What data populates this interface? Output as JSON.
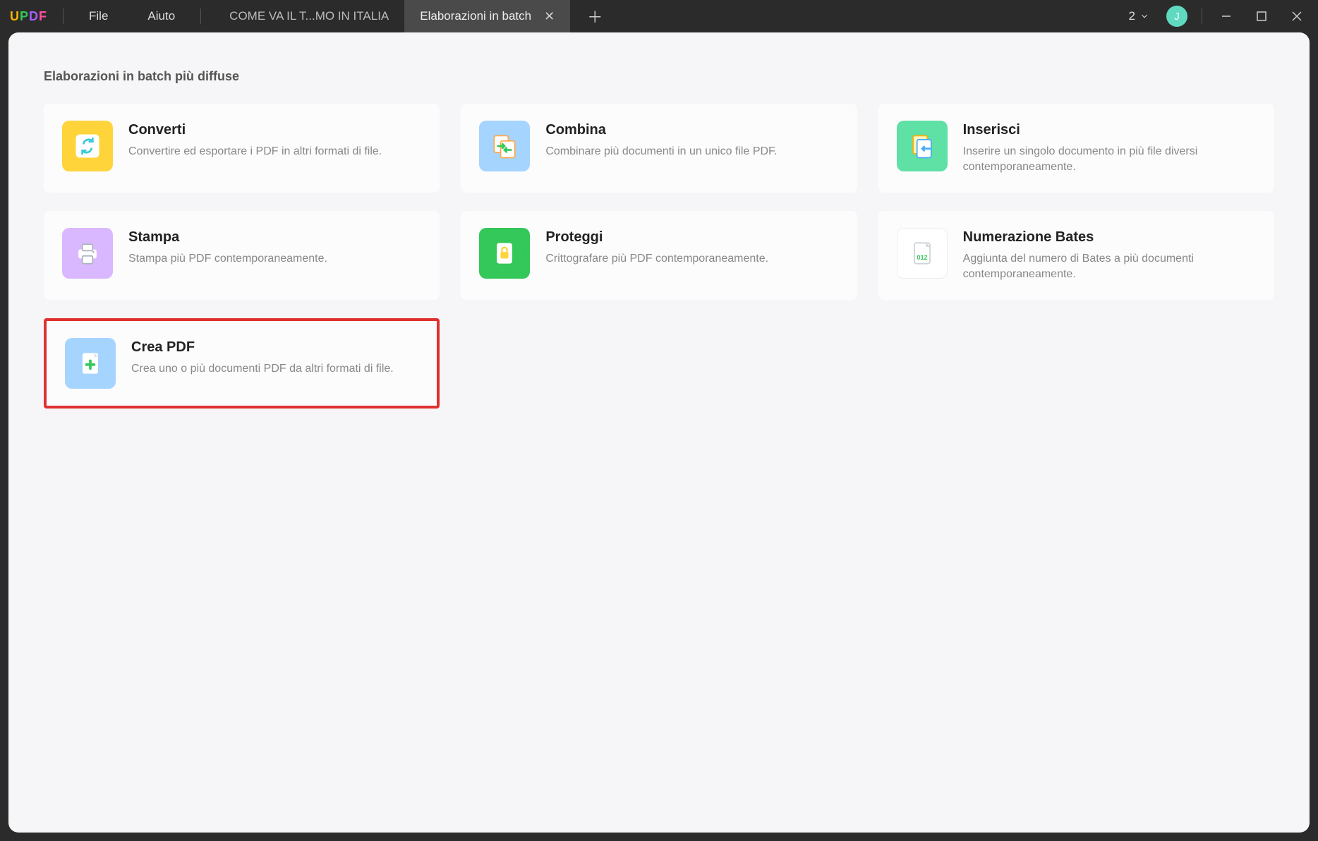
{
  "app": {
    "logo": "UPDF"
  },
  "menu": {
    "file": "File",
    "help": "Aiuto"
  },
  "tabs": {
    "inactive": "COME VA IL T...MO IN ITALIA",
    "active": "Elaborazioni in batch"
  },
  "titlebar": {
    "count": "2",
    "avatar_initial": "J"
  },
  "section_title": "Elaborazioni in batch più diffuse",
  "cards": {
    "convert": {
      "title": "Converti",
      "desc": "Convertire ed esportare i PDF in altri formati di file."
    },
    "combine": {
      "title": "Combina",
      "desc": "Combinare più documenti in un unico file PDF."
    },
    "insert": {
      "title": "Inserisci",
      "desc": "Inserire un singolo documento in più file diversi contemporaneamente."
    },
    "print": {
      "title": "Stampa",
      "desc": "Stampa più PDF contemporaneamente."
    },
    "protect": {
      "title": "Proteggi",
      "desc": "Crittografare più PDF contemporaneamente."
    },
    "bates": {
      "title": "Numerazione Bates",
      "desc": "Aggiunta del numero di Bates a più documenti contemporaneamente."
    },
    "create": {
      "title": "Crea PDF",
      "desc": "Crea uno o più documenti PDF da altri formati di file."
    }
  }
}
